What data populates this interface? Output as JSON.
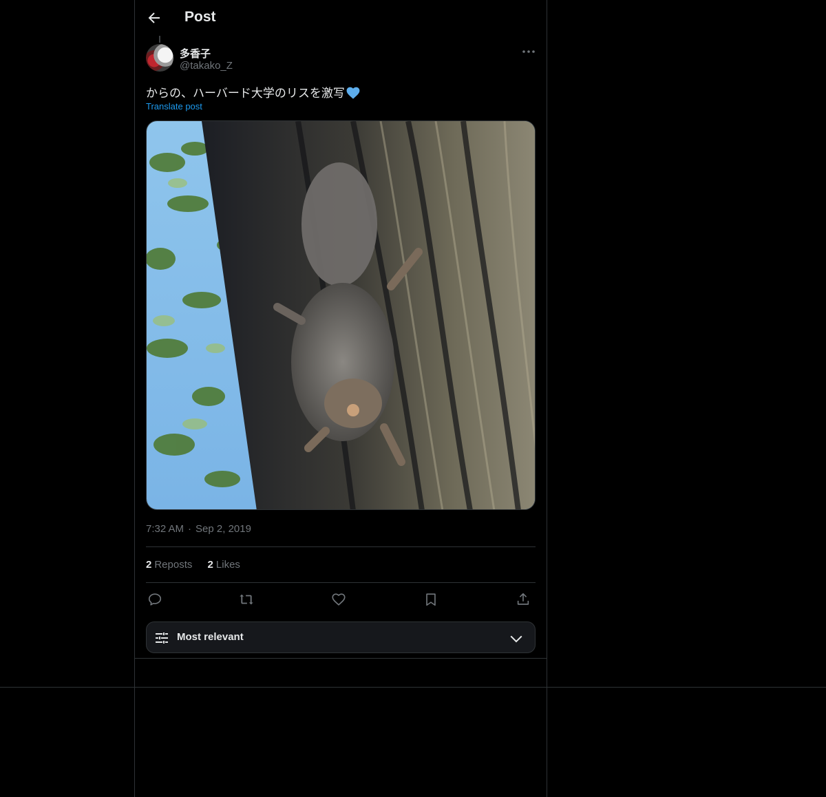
{
  "header": {
    "title": "Post"
  },
  "post": {
    "author_name": "多香子",
    "author_handle": "@takako_Z",
    "text": "からの、ハーバード大学のリスを激写",
    "translate_label": "Translate post",
    "time": "7:32 AM",
    "date": "Sep 2, 2019",
    "reposts_count": "2",
    "reposts_label": "Reposts",
    "likes_count": "2",
    "likes_label": "Likes"
  },
  "sort": {
    "label": "Most relevant"
  },
  "icons": {
    "back": "arrow-left-icon",
    "more": "more-horizontal-icon",
    "reply": "reply-icon",
    "repost": "repost-icon",
    "like": "heart-icon",
    "bookmark": "bookmark-icon",
    "share": "share-icon",
    "sort": "tune-icon",
    "dropdown": "chevron-down-icon",
    "emoji": "blue-heart-emoji"
  },
  "colors": {
    "accent": "#1d9bf0",
    "emoji_heart": "#5dadec",
    "text": "#e7e9ea",
    "muted": "#71767b",
    "border": "#2f3336"
  }
}
